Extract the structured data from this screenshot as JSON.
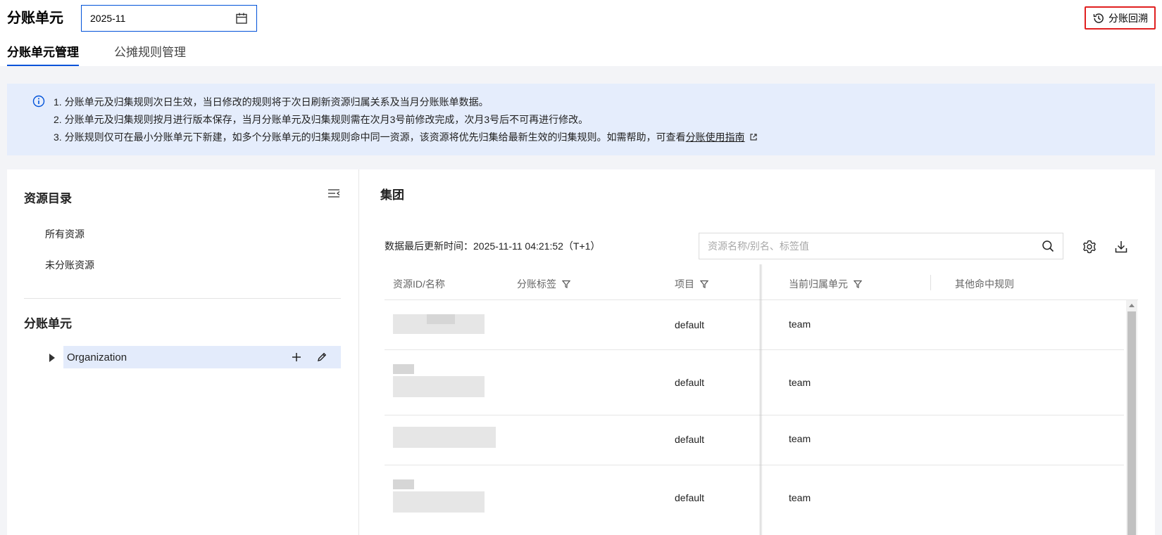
{
  "header": {
    "title": "分账单元",
    "date_value": "2025-11",
    "history_label": "分账回溯",
    "tabs": [
      {
        "label": "分账单元管理",
        "active": true
      },
      {
        "label": "公摊规则管理",
        "active": false
      }
    ]
  },
  "notice": {
    "lines": [
      "1. 分账单元及归集规则次日生效，当日修改的规则将于次日刷新资源归属关系及当月分账账单数据。",
      "2. 分账单元及归集规则按月进行版本保存，当月分账单元及归集规则需在次月3号前修改完成，次月3号后不可再进行修改。",
      "3. 分账规则仅可在最小分账单元下新建，如多个分账单元的归集规则命中同一资源，该资源将优先归集给最新生效的归集规则。如需帮助，可查看"
    ],
    "link_text": "分账使用指南"
  },
  "sidebar": {
    "catalog_title": "资源目录",
    "items": [
      {
        "label": "所有资源"
      },
      {
        "label": "未分账资源"
      }
    ],
    "units_title": "分账单元",
    "tree": [
      {
        "label": "Organization",
        "selected": true
      }
    ]
  },
  "main": {
    "group_title": "集团",
    "update_time": "数据最后更新时间：2025-11-11 04:21:52（T+1）",
    "search_placeholder": "资源名称/别名、标签值",
    "columns": [
      {
        "label": "资源ID/名称",
        "filter": false
      },
      {
        "label": "分账标签",
        "filter": true
      },
      {
        "label": "项目",
        "filter": true
      },
      {
        "label": "当前归属单元",
        "filter": true
      },
      {
        "label": "其他命中规则",
        "filter": false
      }
    ],
    "rows": [
      {
        "project": "default",
        "unit": "team"
      },
      {
        "project": "default",
        "unit": "team"
      },
      {
        "project": "default",
        "unit": "team"
      },
      {
        "project": "default",
        "unit": "team"
      }
    ]
  },
  "colors": {
    "accent": "#0052d9",
    "highlight_border": "#e02020",
    "notice_bg": "#e5edfc",
    "selected_bg": "#e3ebfb"
  },
  "icons": [
    "calendar-icon",
    "history-icon",
    "info-icon",
    "external-link-icon",
    "collapse-icon",
    "caret-right-icon",
    "plus-icon",
    "edit-icon",
    "search-icon",
    "gear-icon",
    "download-icon",
    "filter-icon"
  ]
}
